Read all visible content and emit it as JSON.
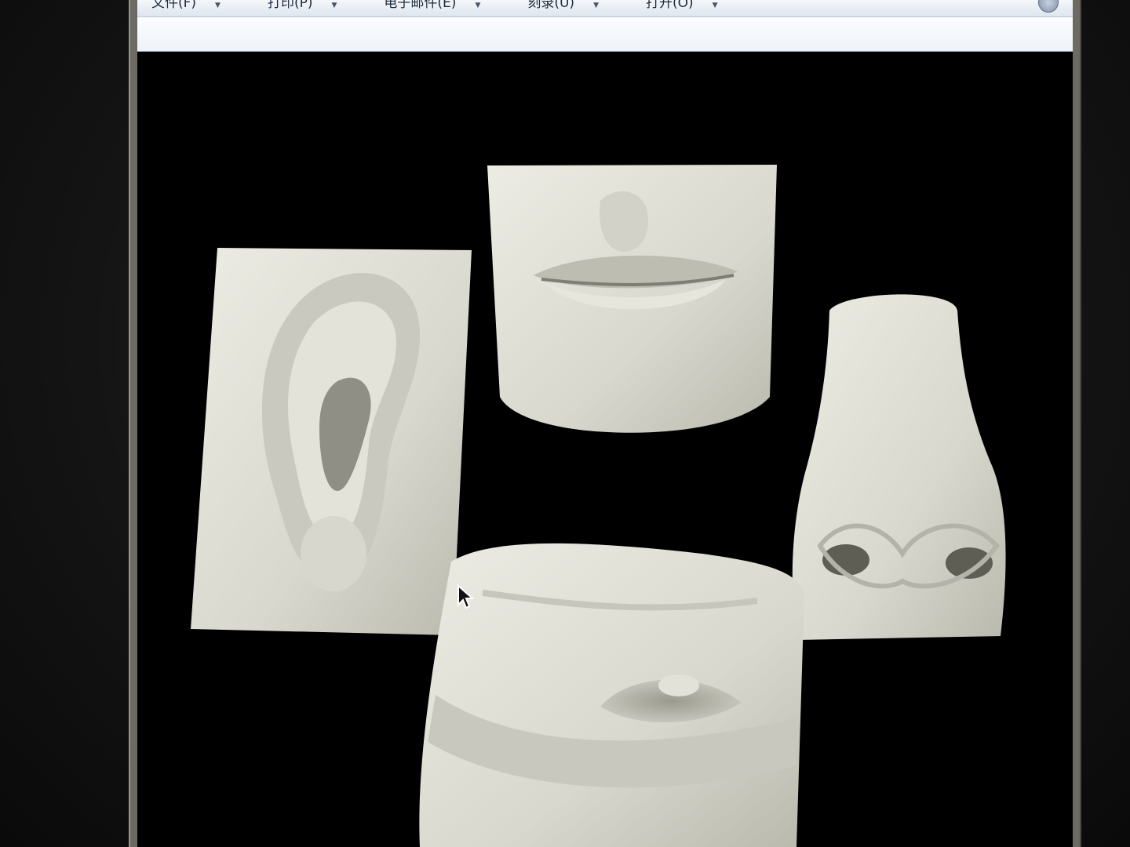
{
  "toolbar": {
    "menu": [
      {
        "label": "文件(F)",
        "icon": "chevron-down-icon"
      },
      {
        "label": "打印(P)",
        "icon": "chevron-down-icon"
      },
      {
        "label": "电子邮件(E)",
        "icon": "chevron-down-icon"
      },
      {
        "label": "刻录(U)",
        "icon": "chevron-down-icon"
      },
      {
        "label": "打开(O)",
        "icon": "chevron-down-icon"
      }
    ],
    "help_icon": "help-icon"
  },
  "viewer": {
    "image_subject": [
      "plaster-ear",
      "plaster-mouth",
      "plaster-nose",
      "plaster-eye"
    ],
    "background_color": "#000000",
    "plaster_color": "#dcdcd2"
  },
  "cursor": {
    "icon": "mouse-pointer-icon"
  }
}
